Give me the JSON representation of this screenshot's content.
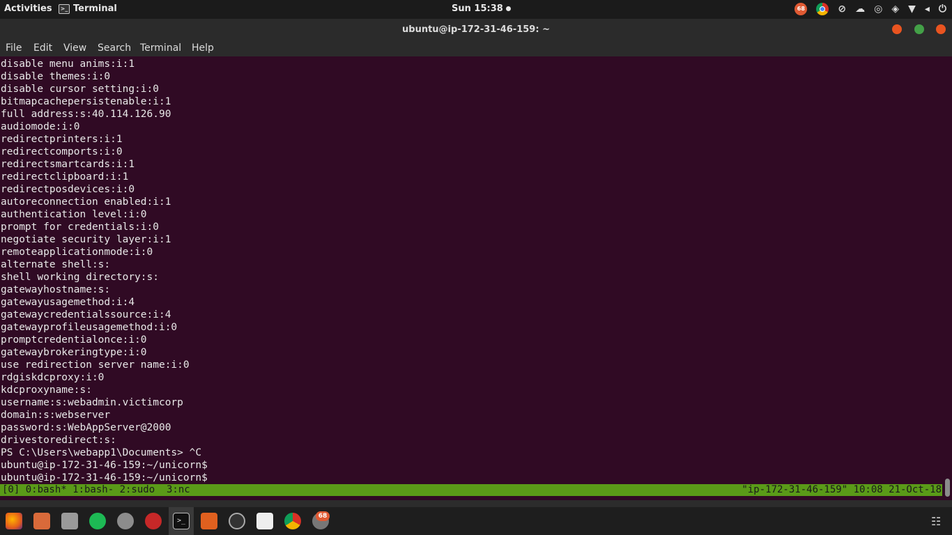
{
  "topbar": {
    "activities": "Activities",
    "app_name": "Terminal",
    "clock": "Sun 15:38",
    "tray_badge": "68"
  },
  "window": {
    "title": "ubuntu@ip-172-31-46-159: ~"
  },
  "menu": {
    "items": [
      "File",
      "Edit",
      "View",
      "Search",
      "Terminal",
      "Help"
    ]
  },
  "terminal": {
    "lines": [
      "disable menu anims:i:1",
      "disable themes:i:0",
      "disable cursor setting:i:0",
      "bitmapcachepersistenable:i:1",
      "full address:s:40.114.126.90",
      "audiomode:i:0",
      "redirectprinters:i:1",
      "redirectcomports:i:0",
      "redirectsmartcards:i:1",
      "redirectclipboard:i:1",
      "redirectposdevices:i:0",
      "autoreconnection enabled:i:1",
      "authentication level:i:0",
      "prompt for credentials:i:0",
      "negotiate security layer:i:1",
      "remoteapplicationmode:i:0",
      "alternate shell:s:",
      "shell working directory:s:",
      "gatewayhostname:s:",
      "gatewayusagemethod:i:4",
      "gatewaycredentialssource:i:4",
      "gatewayprofileusagemethod:i:0",
      "promptcredentialonce:i:0",
      "gatewaybrokeringtype:i:0",
      "use redirection server name:i:0",
      "rdgiskdcproxy:i:0",
      "kdcproxyname:s:",
      "username:s:webadmin.victimcorp",
      "domain:s:webserver",
      "password:s:WebAppServer@2000",
      "drivestoredirect:s:",
      "PS C:\\Users\\webapp1\\Documents> ^C",
      "ubuntu@ip-172-31-46-159:~/unicorn$",
      "ubuntu@ip-172-31-46-159:~/unicorn$ "
    ]
  },
  "tmux": {
    "left": "[0] 0:bash* 1:bash- 2:sudo  3:nc",
    "right": "\"ip-172-31-46-159\" 10:08 21-Oct-18"
  },
  "dock": {
    "badge": "68",
    "items": [
      "firefox-icon",
      "software-icon",
      "files-icon",
      "spotify-icon",
      "monitor-icon",
      "cherry-icon",
      "terminal-icon",
      "sublime-icon",
      "proxy-icon",
      "document-icon",
      "chrome-icon",
      "update-icon"
    ]
  },
  "colors": {
    "terminal_bg": "#300a24",
    "status_bar": "#5a9a18",
    "close_button": "#e95420",
    "maximize_button": "#43a047"
  }
}
